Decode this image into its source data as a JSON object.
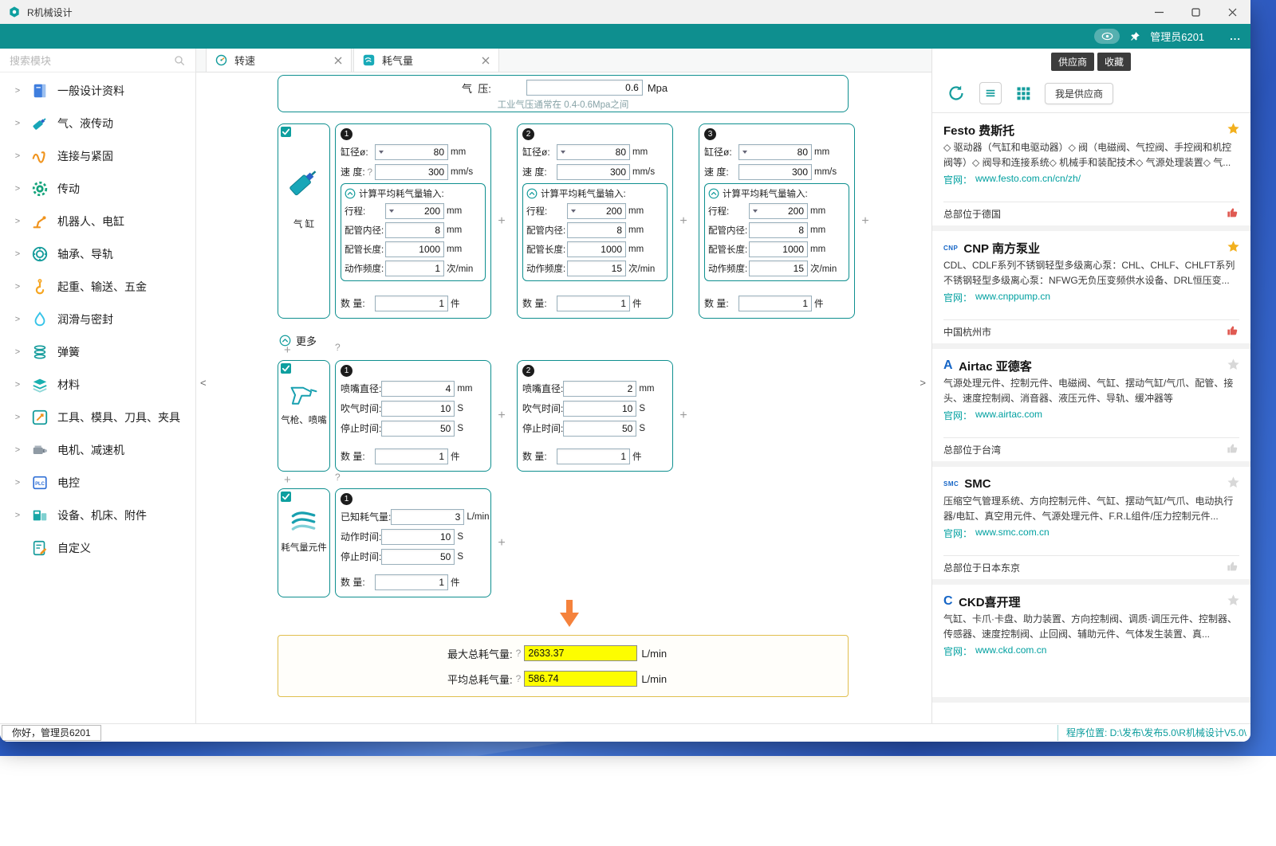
{
  "window": {
    "title": "R机械设计"
  },
  "header": {
    "user": "管理员6201",
    "more_label": "..."
  },
  "sidebar": {
    "search_placeholder": "搜索模块",
    "items": [
      {
        "label": "一般设计资料",
        "icon": "book-icon",
        "chevron": true
      },
      {
        "label": "气、液传动",
        "icon": "pneumatic-icon",
        "chevron": true
      },
      {
        "label": "连接与紧固",
        "icon": "fastener-icon",
        "chevron": true
      },
      {
        "label": "传动",
        "icon": "gear-icon",
        "chevron": true
      },
      {
        "label": "机器人、电缸",
        "icon": "robot-icon",
        "chevron": true
      },
      {
        "label": "轴承、导轨",
        "icon": "bearing-icon",
        "chevron": true
      },
      {
        "label": "起重、输送、五金",
        "icon": "hook-icon",
        "chevron": true
      },
      {
        "label": "润滑与密封",
        "icon": "droplet-icon",
        "chevron": true
      },
      {
        "label": "弹簧",
        "icon": "spring-icon",
        "chevron": true
      },
      {
        "label": "材料",
        "icon": "material-icon",
        "chevron": true
      },
      {
        "label": "工具、模具、刀具、夹具",
        "icon": "tool-icon",
        "chevron": true
      },
      {
        "label": "电机、减速机",
        "icon": "motor-icon",
        "chevron": true
      },
      {
        "label": "电控",
        "icon": "plc-icon",
        "chevron": true
      },
      {
        "label": "设备、机床、附件",
        "icon": "equipment-icon",
        "chevron": true
      },
      {
        "label": "自定义",
        "icon": "custom-icon",
        "chevron": false
      }
    ]
  },
  "tabs": [
    {
      "label": "转速",
      "icon": "gauge-icon",
      "active": false
    },
    {
      "label": "耗气量",
      "icon": "airflow-icon",
      "active": true
    }
  ],
  "calc": {
    "add_glyph": "+",
    "help_glyph": "?",
    "more_label": "更多",
    "pressure": {
      "label": "气  压:",
      "value": "0.6",
      "unit": "Mpa",
      "hint": "工业气压通常在 0.4-0.6Mpa之间"
    },
    "cylinder": {
      "group_label": "气 缸",
      "checked": true,
      "panels": [
        {
          "num": "1",
          "rows_top": [
            {
              "label": "缸径ø:",
              "value": "80",
              "unit": "mm",
              "combo": true
            },
            {
              "label": "速 度:",
              "value": "300",
              "unit": "mm/s",
              "help": true
            }
          ],
          "calc_box": {
            "header": "计算平均耗气量输入:",
            "rows": [
              {
                "label": "行程:",
                "value": "200",
                "unit": "mm",
                "combo": true
              },
              {
                "label": "配管内径:",
                "value": "8",
                "unit": "mm"
              },
              {
                "label": "配管长度:",
                "value": "1000",
                "unit": "mm"
              },
              {
                "label": "动作频度:",
                "value": "1",
                "unit": "次/min"
              }
            ]
          },
          "qty": {
            "label": "数 量:",
            "value": "1",
            "unit": "件"
          }
        },
        {
          "num": "2",
          "rows_top": [
            {
              "label": "缸径ø:",
              "value": "80",
              "unit": "mm",
              "combo": true
            },
            {
              "label": "速 度:",
              "value": "300",
              "unit": "mm/s"
            }
          ],
          "calc_box": {
            "header": "计算平均耗气量输入:",
            "rows": [
              {
                "label": "行程:",
                "value": "200",
                "unit": "mm",
                "combo": true
              },
              {
                "label": "配管内径:",
                "value": "8",
                "unit": "mm"
              },
              {
                "label": "配管长度:",
                "value": "1000",
                "unit": "mm"
              },
              {
                "label": "动作频度:",
                "value": "15",
                "unit": "次/min"
              }
            ]
          },
          "qty": {
            "label": "数 量:",
            "value": "1",
            "unit": "件"
          }
        },
        {
          "num": "3",
          "rows_top": [
            {
              "label": "缸径ø:",
              "value": "80",
              "unit": "mm",
              "combo": true
            },
            {
              "label": "速 度:",
              "value": "300",
              "unit": "mm/s"
            }
          ],
          "calc_box": {
            "header": "计算平均耗气量输入:",
            "rows": [
              {
                "label": "行程:",
                "value": "200",
                "unit": "mm",
                "combo": true
              },
              {
                "label": "配管内径:",
                "value": "8",
                "unit": "mm"
              },
              {
                "label": "配管长度:",
                "value": "1000",
                "unit": "mm"
              },
              {
                "label": "动作频度:",
                "value": "15",
                "unit": "次/min"
              }
            ]
          },
          "qty": {
            "label": "数 量:",
            "value": "1",
            "unit": "件"
          }
        }
      ]
    },
    "gun": {
      "group_label": "气枪、喷嘴",
      "checked": true,
      "panels": [
        {
          "num": "1",
          "rows": [
            {
              "label": "喷嘴直径:",
              "value": "4",
              "unit": "mm"
            },
            {
              "label": "吹气时间:",
              "value": "10",
              "unit": "S"
            },
            {
              "label": "停止时间:",
              "value": "50",
              "unit": "S"
            }
          ],
          "qty": {
            "label": "数 量:",
            "value": "1",
            "unit": "件"
          }
        },
        {
          "num": "2",
          "rows": [
            {
              "label": "喷嘴直径:",
              "value": "2",
              "unit": "mm"
            },
            {
              "label": "吹气时间:",
              "value": "10",
              "unit": "S"
            },
            {
              "label": "停止时间:",
              "value": "50",
              "unit": "S"
            }
          ],
          "qty": {
            "label": "数 量:",
            "value": "1",
            "unit": "件"
          }
        }
      ]
    },
    "element": {
      "group_label": "耗气量元件",
      "checked": true,
      "panels": [
        {
          "num": "1",
          "rows": [
            {
              "label": "已知耗气量:",
              "value": "3",
              "unit": "L/min"
            },
            {
              "label": "动作时间:",
              "value": "10",
              "unit": "S"
            },
            {
              "label": "停止时间:",
              "value": "50",
              "unit": "S"
            }
          ],
          "qty": {
            "label": "数 量:",
            "value": "1",
            "unit": "件"
          }
        }
      ]
    },
    "results": [
      {
        "label": "最大总耗气量:",
        "value": "2633.37",
        "unit": "L/min"
      },
      {
        "label": "平均总耗气量:",
        "value": "586.74",
        "unit": "L/min"
      }
    ]
  },
  "supplier": {
    "tabs": [
      "供应商",
      "收藏"
    ],
    "vendor_button": "我是供应商",
    "site_prefix": "官网：",
    "cards": [
      {
        "logo": "",
        "name": "Festo 费斯托",
        "starred": true,
        "liked": true,
        "desc": "◇ 驱动器（气缸和电驱动器）◇ 阀（电磁阀、气控阀、手控阀和机控阀等）◇ 阀导和连接系统◇ 机械手和装配技术◇ 气源处理装置◇ 气...",
        "site": "www.festo.com.cn/cn/zh/",
        "location": "总部位于德国"
      },
      {
        "logo": "CNP",
        "name": "CNP 南方泵业",
        "starred": true,
        "liked": true,
        "desc": "CDL、CDLF系列不锈钢轻型多级离心泵：CHL、CHLF、CHLFT系列不锈钢轻型多级离心泵：NFWG无负压变频供水设备、DRL恒压变...",
        "site": "www.cnppump.cn",
        "location": "中国杭州市"
      },
      {
        "logo": "A",
        "name": "Airtac 亚德客",
        "starred": false,
        "liked": false,
        "desc": "气源处理元件、控制元件、电磁阀、气缸、摆动气缸/气爪、配管、接头、速度控制阀、消音器、液压元件、导轨、缓冲器等",
        "site": "www.airtac.com",
        "location": "总部位于台湾"
      },
      {
        "logo": "SMC",
        "name": "SMC",
        "starred": false,
        "liked": false,
        "desc": "压缩空气管理系统、方向控制元件、气缸、摆动气缸/气爪、电动执行器/电缸、真空用元件、气源处理元件、F.R.L组件/压力控制元件...",
        "site": "www.smc.com.cn",
        "location": "总部位于日本东京"
      },
      {
        "logo": "C",
        "name": "CKD喜开理",
        "starred": false,
        "liked": false,
        "desc": "气缸、卡爪·卡盘、助力装置、方向控制阀、调质·调压元件、控制器、传感器、速度控制阀、止回阀、辅助元件、气体发生装置、真...",
        "site": "www.ckd.com.cn",
        "location": ""
      }
    ]
  },
  "statusbar": {
    "greeting": "你好，管理员6201",
    "location": "程序位置: D:\\发布\\发布5.0\\R机械设计V5.0\\"
  }
}
